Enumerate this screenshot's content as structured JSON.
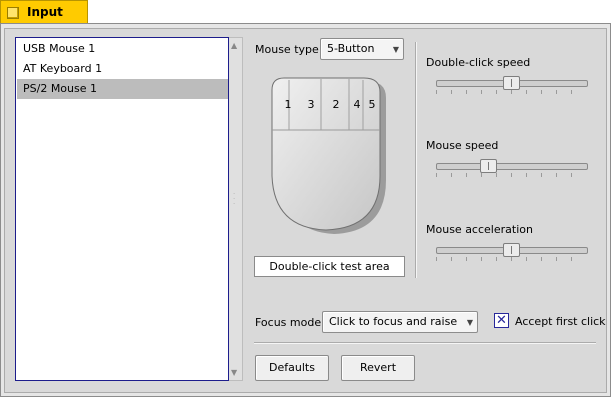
{
  "window": {
    "title": "Input"
  },
  "devices": {
    "items": [
      {
        "label": "USB Mouse 1",
        "selected": false
      },
      {
        "label": "AT Keyboard 1",
        "selected": false
      },
      {
        "label": "PS/2 Mouse 1",
        "selected": true
      }
    ]
  },
  "mouse_type": {
    "label": "Mouse type:",
    "value": "5-Button"
  },
  "mouse_buttons": [
    "1",
    "3",
    "2",
    "4",
    "5"
  ],
  "test_area": {
    "label": "Double-click test area"
  },
  "sliders": [
    {
      "label": "Double-click speed",
      "level": 0.5
    },
    {
      "label": "Mouse speed",
      "level": 0.33
    },
    {
      "label": "Mouse acceleration",
      "level": 0.5
    }
  ],
  "focus": {
    "label": "Focus mode:",
    "value": "Click to focus and raise"
  },
  "accept_first_click": {
    "label": "Accept first click",
    "checked": true,
    "mark": "✕"
  },
  "buttons": {
    "defaults": "Defaults",
    "revert": "Revert"
  },
  "colors": {
    "tab": "#ffcb00",
    "selection": "#bcbcbc",
    "list_border": "#1d1d8c"
  }
}
